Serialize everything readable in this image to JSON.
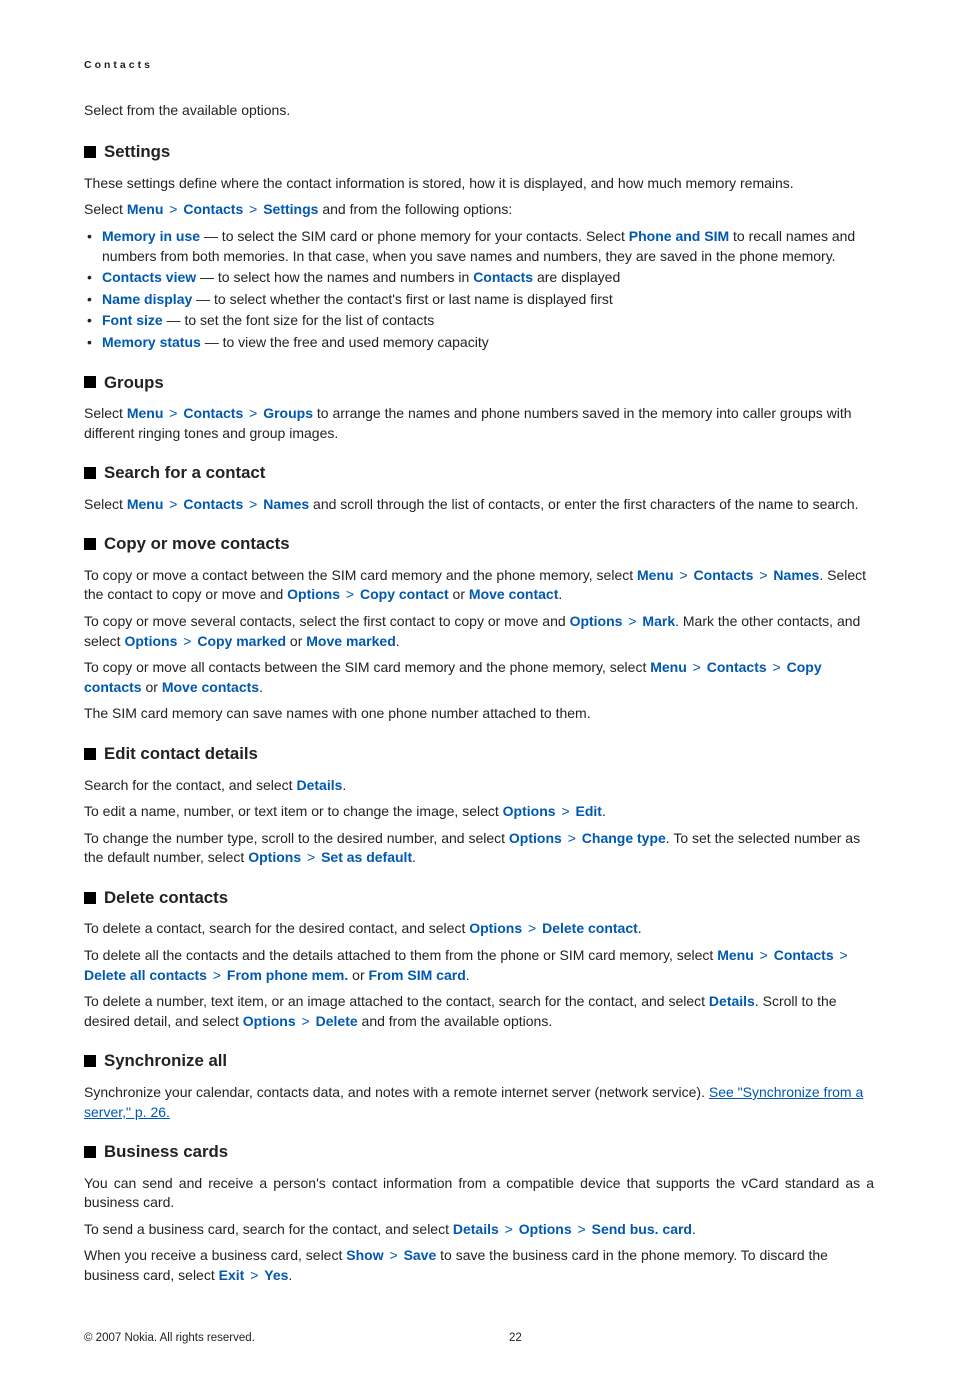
{
  "header": "Contacts",
  "introLine": "Select from the available options.",
  "sections": {
    "settings": {
      "title": "Settings",
      "p1": "These settings define where the contact information is stored, how it is displayed, and how much memory remains.",
      "p2_pre": "Select ",
      "menu": "Menu",
      "contacts": "Contacts",
      "settings": "Settings",
      "p2_post": " and from the following options:",
      "items": [
        {
          "label": "Memory in use",
          "dash": "  —  to select the SIM card or phone memory for your contacts. Select ",
          "em": "Phone and SIM",
          "tail": " to recall names and numbers from both memories. In that case, when you save names and numbers, they are saved in the phone memory."
        },
        {
          "label": "Contacts view",
          "dash": "  —  to select how the names and numbers in ",
          "em": "Contacts",
          "tail": " are displayed"
        },
        {
          "label": "Name display",
          "dash": " —  to select whether the contact's first or last name is displayed first",
          "em": "",
          "tail": ""
        },
        {
          "label": "Font size",
          "dash": "  —  to set the font size for the list of contacts",
          "em": "",
          "tail": ""
        },
        {
          "label": "Memory status",
          "dash": " —   to view the free and used memory capacity",
          "em": "",
          "tail": ""
        }
      ]
    },
    "groups": {
      "title": "Groups",
      "pre": "Select ",
      "menu": "Menu",
      "contacts": "Contacts",
      "groups": "Groups",
      "post": " to arrange the names and phone numbers saved in the memory into caller groups with different ringing tones and group images."
    },
    "search": {
      "title": "Search for a contact",
      "pre": "Select ",
      "menu": "Menu",
      "contacts": "Contacts",
      "names": "Names",
      "post": " and scroll through the list of contacts, or enter the first characters of the name to search."
    },
    "copy": {
      "title": "Copy or move contacts",
      "p1_a": "To copy or move a contact between the SIM card memory and the phone memory, select ",
      "menu": "Menu",
      "contacts": "Contacts",
      "names": "Names",
      "p1_b": ". Select the contact to copy or move and ",
      "options": "Options",
      "copyContact": "Copy contact",
      "or": " or ",
      "moveContact": "Move contact",
      "dot": ".",
      "p2_a": "To copy or move several contacts, select the first contact to copy or move and ",
      "mark": "Mark",
      "p2_b": ". Mark the other contacts, and select ",
      "copyMarked": "Copy marked",
      "moveMarked": "Move marked",
      "p3_a": "To copy or move all contacts between the SIM card memory and the phone memory, select ",
      "copyContacts": "Copy contacts",
      "moveContacts": "Move contacts",
      "p4": "The SIM card memory can save names with one phone number attached to them."
    },
    "edit": {
      "title": "Edit contact details",
      "p1_a": "Search for the contact, and select ",
      "details": "Details",
      "dot": ".",
      "p2_a": "To edit a name, number, or text item or to change the image, select ",
      "options": "Options",
      "edit": "Edit",
      "p3_a": "To change the number type, scroll to the desired number, and select ",
      "changeType": "Change type",
      "p3_b": ". To set the selected number as the default number, select ",
      "setDefault": "Set as default"
    },
    "delete": {
      "title": "Delete contacts",
      "p1_a": "To delete a contact, search for the desired contact, and select ",
      "options": "Options",
      "deleteContact": "Delete contact",
      "dot": ".",
      "p2_a": "To delete all the contacts and the details attached to them from the phone or SIM card memory, select ",
      "menu": "Menu",
      "contacts": "Contacts",
      "deleteAll": "Delete all contacts",
      "fromPhone": "From phone mem.",
      "or": " or ",
      "fromSim": "From SIM card",
      "p3_a": "To delete a number, text item, or an image attached to the contact, search for the contact, and select ",
      "details": "Details",
      "p3_b": ". Scroll to the desired detail, and select ",
      "delete": "Delete",
      "p3_c": " and from the available options."
    },
    "sync": {
      "title": "Synchronize all",
      "p_a": "Synchronize your calendar, contacts data, and notes with a remote internet server (network service). ",
      "link": "See \"Synchronize from a server,\" p. 26."
    },
    "biz": {
      "title": "Business cards",
      "p1": "You can send and receive a person's contact information from a compatible device that supports the vCard standard as a business card.",
      "p2_a": "To send a business card, search for the contact, and select ",
      "details": "Details",
      "options": "Options",
      "sendBus": "Send bus. card",
      "dot": ".",
      "p3_a": "When you receive a business card, select ",
      "show": "Show",
      "save": "Save",
      "p3_b": " to save the business card in the phone memory. To discard the business card, select ",
      "exit": "Exit",
      "yes": "Yes"
    }
  },
  "footer": {
    "copyright": "© 2007 Nokia. All rights reserved.",
    "page": "22"
  }
}
